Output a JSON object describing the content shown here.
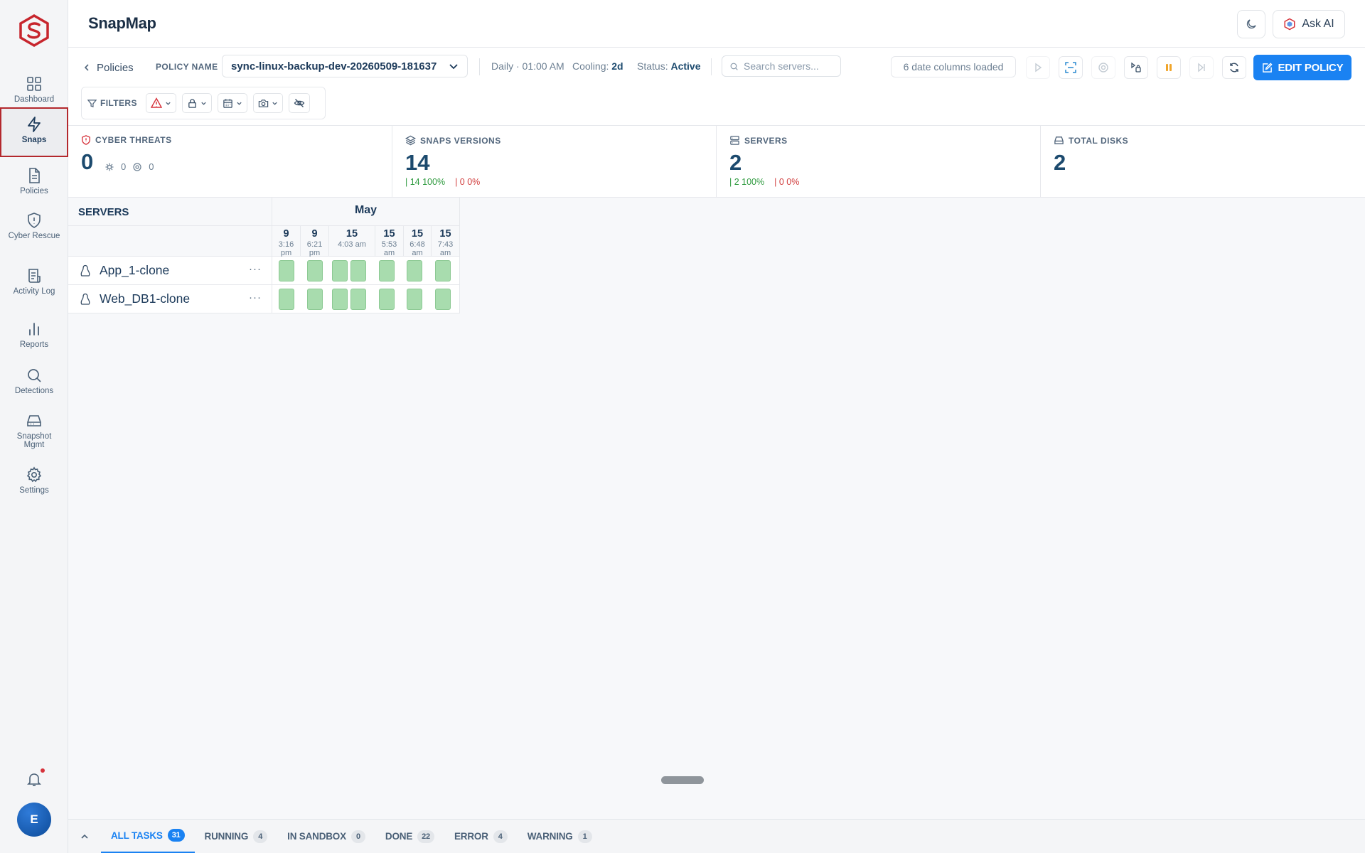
{
  "colors": {
    "brand": "#b3282d",
    "accent": "#1a82f2",
    "snap_cell": "#a8dcae"
  },
  "sidebar": {
    "items": [
      {
        "label": "Dashboard",
        "icon": "grid-icon"
      },
      {
        "label": "Snaps",
        "icon": "lightning-icon",
        "active": true
      },
      {
        "label": "Policies",
        "icon": "document-icon"
      },
      {
        "label": "Cyber Rescue",
        "icon": "shield-icon"
      },
      {
        "label": "Activity Log",
        "icon": "log-icon"
      },
      {
        "label": "Reports",
        "icon": "bar-chart-icon"
      },
      {
        "label": "Detections",
        "icon": "search-icon"
      },
      {
        "label": "Snapshot Mgmt",
        "icon": "drive-icon"
      },
      {
        "label": "Settings",
        "icon": "gear-icon"
      }
    ],
    "avatar_initial": "E"
  },
  "header": {
    "title": "SnapMap",
    "ask_ai_label": "Ask AI"
  },
  "toolbar": {
    "breadcrumb": "Policies",
    "policy_label": "POLICY NAME",
    "policy_name": "sync-linux-backup-dev-20260509-181637",
    "schedule": "Daily · 01:00 AM",
    "cooling_label": "Cooling:",
    "cooling_value": "2d",
    "status_label": "Status:",
    "status_value": "Active",
    "search_placeholder": "Search servers...",
    "columns_loaded": "6 date columns loaded",
    "edit_label": "EDIT POLICY",
    "filters_label": "FILTERS"
  },
  "stats": {
    "cyber_threats": {
      "label": "CYBER THREATS",
      "value": "0",
      "sub1": "0",
      "sub2": "0"
    },
    "snaps_versions": {
      "label": "SNAPS VERSIONS",
      "value": "14",
      "ok": "| 14 100%",
      "bad": "| 0 0%"
    },
    "servers": {
      "label": "SERVERS",
      "value": "2",
      "ok": "| 2 100%",
      "bad": "| 0 0%"
    },
    "total_disks": {
      "label": "TOTAL DISKS",
      "value": "2"
    }
  },
  "grid": {
    "servers_header": "SERVERS",
    "month": "May",
    "columns": [
      {
        "day": "9",
        "time1": "3:16",
        "time2": "pm"
      },
      {
        "day": "9",
        "time1": "6:21",
        "time2": "pm"
      },
      {
        "day": "15",
        "time1": "4:03 am",
        "time2": ""
      },
      {
        "day": "15",
        "time1": "5:53",
        "time2": "am"
      },
      {
        "day": "15",
        "time1": "6:48",
        "time2": "am"
      },
      {
        "day": "15",
        "time1": "7:43",
        "time2": "am"
      }
    ],
    "rows": [
      {
        "name": "App_1-clone"
      },
      {
        "name": "Web_DB1-clone"
      }
    ]
  },
  "footer": {
    "tabs": [
      {
        "label": "ALL TASKS",
        "count": "31",
        "active": true
      },
      {
        "label": "RUNNING",
        "count": "4"
      },
      {
        "label": "IN SANDBOX",
        "count": "0"
      },
      {
        "label": "DONE",
        "count": "22"
      },
      {
        "label": "ERROR",
        "count": "4"
      },
      {
        "label": "WARNING",
        "count": "1"
      }
    ]
  }
}
